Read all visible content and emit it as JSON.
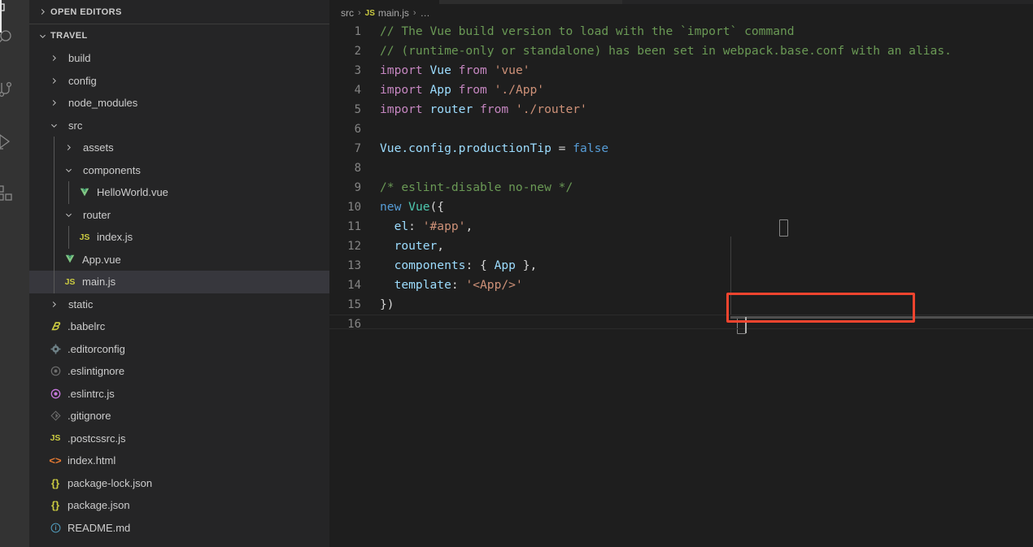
{
  "window": {
    "theme": "Dark+ (default dark)",
    "background": "#1e1e1e",
    "sidebar_background": "#252526",
    "activitybar_background": "#333333",
    "accent_red": "#f2442e",
    "selection_background": "#37373d"
  },
  "activity_bar": {
    "items": [
      {
        "name": "explorer-icon",
        "label": "Explorer",
        "active": true
      },
      {
        "name": "search-icon",
        "label": "Search",
        "active": false
      },
      {
        "name": "source-control-icon",
        "label": "Source Control",
        "active": false
      },
      {
        "name": "run-debug-icon",
        "label": "Run and Debug",
        "active": false
      },
      {
        "name": "extensions-icon",
        "label": "Extensions",
        "active": false
      }
    ]
  },
  "sidebar": {
    "open_editors": {
      "title": "OPEN EDITORS",
      "expanded": false
    },
    "folder": {
      "title": "TRAVEL",
      "expanded": true
    },
    "tree": [
      {
        "label": "build",
        "depth": 1,
        "type": "folder",
        "expanded": false,
        "icon": "chevron-right-icon",
        "selected": false
      },
      {
        "label": "config",
        "depth": 1,
        "type": "folder",
        "expanded": false,
        "icon": "chevron-right-icon",
        "selected": false
      },
      {
        "label": "node_modules",
        "depth": 1,
        "type": "folder",
        "expanded": false,
        "icon": "chevron-right-icon",
        "selected": false
      },
      {
        "label": "src",
        "depth": 1,
        "type": "folder",
        "expanded": true,
        "icon": "chevron-down-icon",
        "selected": false
      },
      {
        "label": "assets",
        "depth": 2,
        "type": "folder",
        "expanded": false,
        "icon": "chevron-right-icon",
        "selected": false
      },
      {
        "label": "components",
        "depth": 2,
        "type": "folder",
        "expanded": true,
        "icon": "chevron-down-icon",
        "selected": false
      },
      {
        "label": "HelloWorld.vue",
        "depth": 3,
        "type": "file",
        "icon": "vue-icon",
        "selected": false
      },
      {
        "label": "router",
        "depth": 2,
        "type": "folder",
        "expanded": true,
        "icon": "chevron-down-icon",
        "selected": false
      },
      {
        "label": "index.js",
        "depth": 3,
        "type": "file",
        "icon": "js-icon",
        "selected": false
      },
      {
        "label": "App.vue",
        "depth": 2,
        "type": "file",
        "icon": "vue-icon",
        "selected": false
      },
      {
        "label": "main.js",
        "depth": 2,
        "type": "file",
        "icon": "js-icon",
        "selected": true
      },
      {
        "label": "static",
        "depth": 1,
        "type": "folder",
        "expanded": false,
        "icon": "chevron-right-icon",
        "selected": false
      },
      {
        "label": ".babelrc",
        "depth": 1,
        "type": "file",
        "icon": "babel-icon",
        "selected": false
      },
      {
        "label": ".editorconfig",
        "depth": 1,
        "type": "file",
        "icon": "gear-icon",
        "selected": false
      },
      {
        "label": ".eslintignore",
        "depth": 1,
        "type": "file",
        "icon": "eslint-gray-icon",
        "selected": false
      },
      {
        "label": ".eslintrc.js",
        "depth": 1,
        "type": "file",
        "icon": "eslint-icon",
        "selected": false
      },
      {
        "label": ".gitignore",
        "depth": 1,
        "type": "file",
        "icon": "git-icon",
        "selected": false
      },
      {
        "label": ".postcssrc.js",
        "depth": 1,
        "type": "file",
        "icon": "js-icon",
        "selected": false
      },
      {
        "label": "index.html",
        "depth": 1,
        "type": "file",
        "icon": "html-icon",
        "selected": false
      },
      {
        "label": "package-lock.json",
        "depth": 1,
        "type": "file",
        "icon": "json-icon",
        "selected": false
      },
      {
        "label": "package.json",
        "depth": 1,
        "type": "file",
        "icon": "json-icon",
        "selected": false
      },
      {
        "label": "README.md",
        "depth": 1,
        "type": "file",
        "icon": "info-icon",
        "selected": false
      }
    ]
  },
  "editor": {
    "breadcrumb": {
      "folder": "src",
      "separator": "›",
      "file": "main.js",
      "file_icon": "js-icon",
      "overflow": "…"
    },
    "active_file": "main.js",
    "annotation": {
      "shape": "rectangle",
      "color": "#f2442e",
      "target_line": 14,
      "target_text": "template: '<App/>'"
    },
    "lines": [
      {
        "n": "1",
        "tokens": [
          {
            "t": "// The Vue build version to load with the `import` command",
            "c": "t-comment"
          }
        ]
      },
      {
        "n": "2",
        "tokens": [
          {
            "t": "// (runtime-only or standalone) has been set in webpack.base.conf with an alias.",
            "c": "t-comment"
          }
        ]
      },
      {
        "n": "3",
        "tokens": [
          {
            "t": "import ",
            "c": "t-kw"
          },
          {
            "t": "Vue",
            "c": "t-ident"
          },
          {
            "t": " from ",
            "c": "t-kw"
          },
          {
            "t": "'vue'",
            "c": "t-str"
          }
        ]
      },
      {
        "n": "4",
        "tokens": [
          {
            "t": "import ",
            "c": "t-kw"
          },
          {
            "t": "App",
            "c": "t-ident"
          },
          {
            "t": " from ",
            "c": "t-kw"
          },
          {
            "t": "'./App'",
            "c": "t-str"
          }
        ]
      },
      {
        "n": "5",
        "tokens": [
          {
            "t": "import ",
            "c": "t-kw"
          },
          {
            "t": "router",
            "c": "t-ident"
          },
          {
            "t": " from ",
            "c": "t-kw"
          },
          {
            "t": "'./router'",
            "c": "t-str"
          }
        ]
      },
      {
        "n": "6",
        "tokens": []
      },
      {
        "n": "7",
        "tokens": [
          {
            "t": "Vue",
            "c": "t-ident"
          },
          {
            "t": ".config.productionTip",
            "c": "t-ident"
          },
          {
            "t": " = ",
            "c": "t-plain"
          },
          {
            "t": "false",
            "c": "t-blue"
          }
        ]
      },
      {
        "n": "8",
        "tokens": []
      },
      {
        "n": "9",
        "tokens": [
          {
            "t": "/* eslint-disable no-new */",
            "c": "t-comment"
          }
        ]
      },
      {
        "n": "10",
        "tokens": [
          {
            "t": "new ",
            "c": "t-blue"
          },
          {
            "t": "Vue",
            "c": "t-class"
          },
          {
            "t": "({",
            "c": "t-plain"
          }
        ]
      },
      {
        "n": "11",
        "tokens": [
          {
            "t": "  ",
            "c": "t-plain"
          },
          {
            "t": "el",
            "c": "t-ident"
          },
          {
            "t": ": ",
            "c": "t-plain"
          },
          {
            "t": "'#app'",
            "c": "t-str"
          },
          {
            "t": ",",
            "c": "t-plain"
          }
        ]
      },
      {
        "n": "12",
        "tokens": [
          {
            "t": "  ",
            "c": "t-plain"
          },
          {
            "t": "router",
            "c": "t-ident"
          },
          {
            "t": ",",
            "c": "t-plain"
          }
        ]
      },
      {
        "n": "13",
        "tokens": [
          {
            "t": "  ",
            "c": "t-plain"
          },
          {
            "t": "components",
            "c": "t-ident"
          },
          {
            "t": ": { ",
            "c": "t-plain"
          },
          {
            "t": "App",
            "c": "t-ident"
          },
          {
            "t": " },",
            "c": "t-plain"
          }
        ]
      },
      {
        "n": "14",
        "tokens": [
          {
            "t": "  ",
            "c": "t-plain"
          },
          {
            "t": "template",
            "c": "t-ident"
          },
          {
            "t": ": ",
            "c": "t-plain"
          },
          {
            "t": "'<App/>'",
            "c": "t-str"
          }
        ]
      },
      {
        "n": "15",
        "tokens": [
          {
            "t": "})",
            "c": "t-plain"
          }
        ]
      },
      {
        "n": "16",
        "tokens": []
      }
    ]
  }
}
